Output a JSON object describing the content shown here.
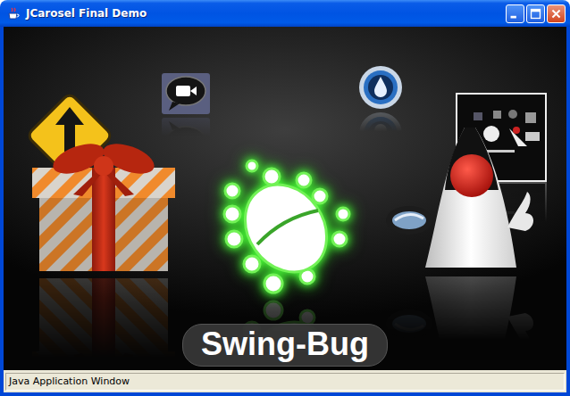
{
  "window": {
    "title": "JCarosel Final Demo"
  },
  "carousel": {
    "items": [
      {
        "kind": "chat",
        "selected": false
      },
      {
        "kind": "drop",
        "selected": false
      },
      {
        "kind": "gift",
        "selected": false
      },
      {
        "kind": "screenshot",
        "selected": false
      },
      {
        "kind": "duke",
        "selected": false
      },
      {
        "kind": "bug",
        "selected": true
      }
    ],
    "caption": "Swing-Bug"
  },
  "status_bar": "Java Application Window"
}
